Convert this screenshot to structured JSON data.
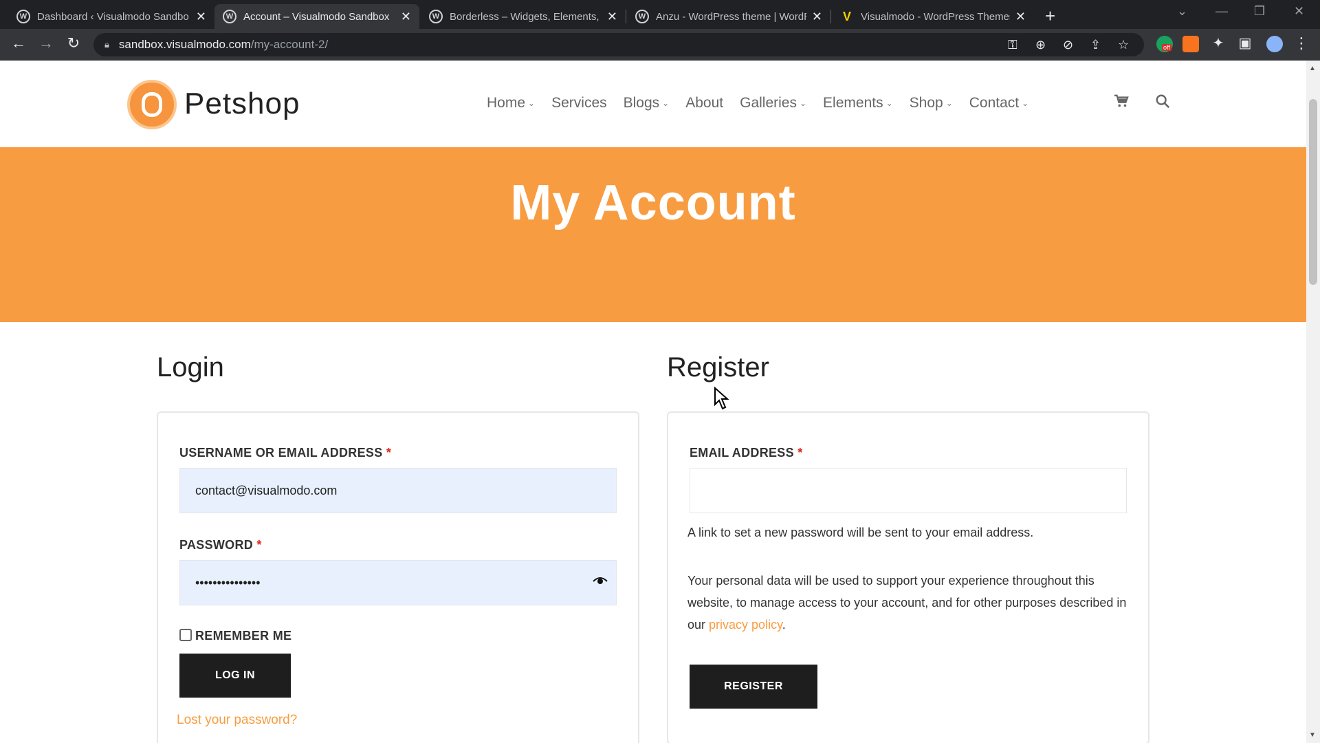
{
  "browser": {
    "tabs": [
      {
        "title": "Dashboard ‹ Visualmodo Sandbo",
        "icon": "wordpress-icon"
      },
      {
        "title": "Account – Visualmodo Sandbox",
        "icon": "wordpress-icon"
      },
      {
        "title": "Borderless – Widgets, Elements, T",
        "icon": "wordpress-icon"
      },
      {
        "title": "Anzu - WordPress theme | WordP",
        "icon": "wordpress-icon"
      },
      {
        "title": "Visualmodo - WordPress Themes",
        "icon": "visualmodo-icon"
      }
    ],
    "close_glyph": "✕",
    "new_tab_glyph": "+",
    "url_host": "sandbox.visualmodo.com",
    "url_path": "/my-account-2/",
    "extension_badge": "off"
  },
  "site": {
    "logo_text": "Petshop",
    "nav": [
      {
        "label": "Home",
        "has_dropdown": true
      },
      {
        "label": "Services",
        "has_dropdown": false
      },
      {
        "label": "Blogs",
        "has_dropdown": true
      },
      {
        "label": "About",
        "has_dropdown": false
      },
      {
        "label": "Galleries",
        "has_dropdown": true
      },
      {
        "label": "Elements",
        "has_dropdown": true
      },
      {
        "label": "Shop",
        "has_dropdown": true
      },
      {
        "label": "Contact",
        "has_dropdown": true
      }
    ],
    "accent": "#f89c41"
  },
  "hero": {
    "title": "My Account"
  },
  "login": {
    "title": "Login",
    "username_label": "USERNAME OR EMAIL ADDRESS",
    "username_value": "contact@visualmodo.com",
    "password_label": "PASSWORD",
    "password_value": "•••••••••••••••",
    "required_mark": "*",
    "remember_label": "REMEMBER ME",
    "remember_checked": false,
    "submit_label": "LOG IN",
    "lost_password": "Lost your password?"
  },
  "register": {
    "title": "Register",
    "email_label": "EMAIL ADDRESS",
    "email_value": "",
    "note": "A link to set a new password will be sent to your email address.",
    "privacy_before": "Your personal data will be used to support your experience throughout this website, to manage access to your account, and for other purposes described in our ",
    "privacy_link": "privacy policy",
    "privacy_after": ".",
    "submit_label": "REGISTER"
  }
}
